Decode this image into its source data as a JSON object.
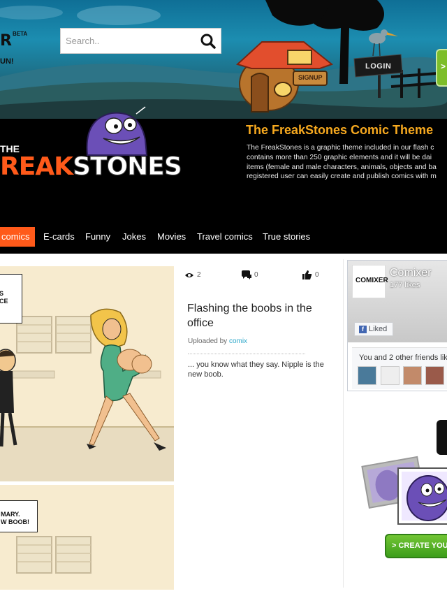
{
  "logo": {
    "badge": "BETA",
    "partial": "R",
    "tagline": "UN!"
  },
  "search": {
    "placeholder": "Search.."
  },
  "header": {
    "login_label": "LOGIN",
    "signup_label": "SIGNUP",
    "green_tab_label": ">"
  },
  "brand": {
    "the": "THE",
    "name_red": "REAK",
    "name_white": "STONES"
  },
  "theme": {
    "title": "The FreakStones Comic Theme",
    "description_lines": [
      "The FreakStones is a graphic theme included in our flash c",
      "contains more than 250 graphic elements and it will be dai",
      "items (female and male characters, animals, objects and ba",
      "registered user can easily create and publish comics with m"
    ]
  },
  "nav": {
    "items": [
      {
        "label": "comics",
        "active": true
      },
      {
        "label": "E-cards"
      },
      {
        "label": "Funny"
      },
      {
        "label": "Jokes"
      },
      {
        "label": "Movies"
      },
      {
        "label": "Travel comics"
      },
      {
        "label": "True stories"
      }
    ]
  },
  "comic": {
    "bubble1_lines": [
      "S",
      "CE"
    ],
    "bubble2_lines": [
      "MARY.",
      "W BOOB!"
    ]
  },
  "post": {
    "views": "2",
    "comments": "0",
    "likes": "0",
    "title": "Flashing the boobs in the office",
    "uploaded_prefix": "Uploaded by ",
    "uploader": "comix",
    "description": "... you know what they say. Nipple is the new boob."
  },
  "facebook": {
    "page_name": "Comixer",
    "likes": "177 likes",
    "liked_label": "Liked",
    "friends_text": "You and 2 other friends lik",
    "logo_text": "COMIXER"
  },
  "cta": {
    "label": "> CREATE YOU"
  },
  "colors": {
    "accent_orange": "#ff5a1a",
    "title_gold": "#f7a91f",
    "link_blue": "#2aa6c9",
    "cta_green": "#4caf23"
  }
}
